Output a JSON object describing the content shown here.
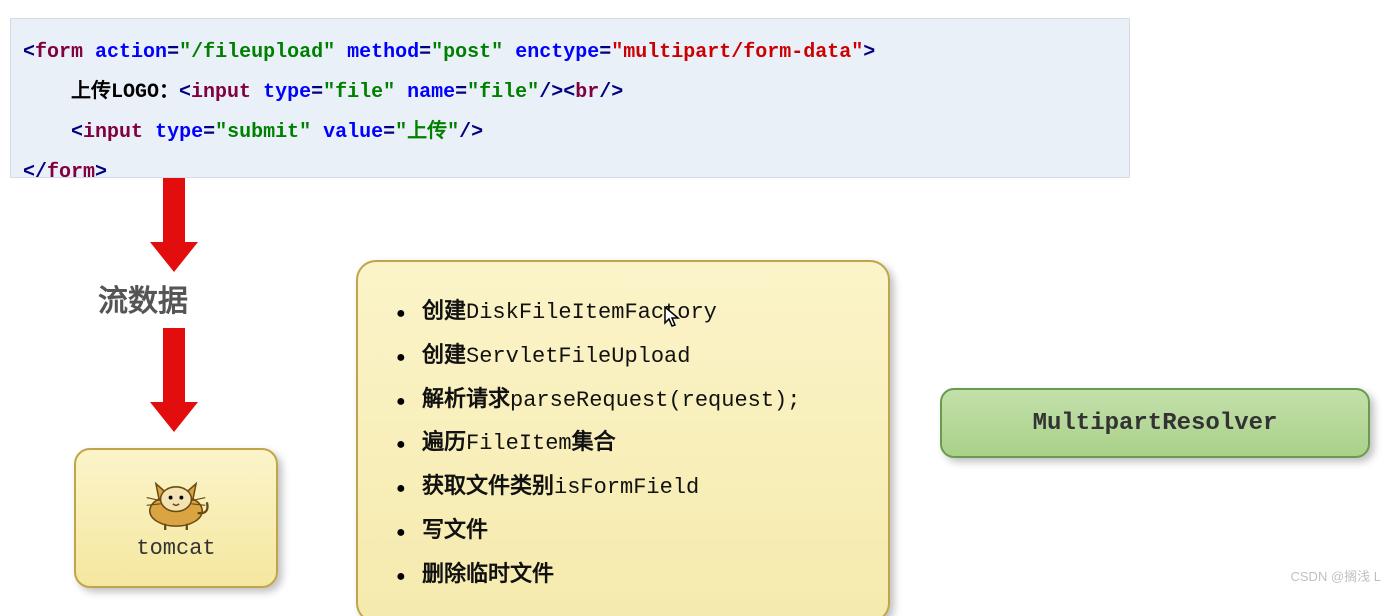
{
  "code": {
    "line1_tag": "form",
    "line1_attr1": "action",
    "line1_val1": "\"/fileupload\"",
    "line1_attr2": "method",
    "line1_val2": "\"post\"",
    "line1_attr3": "enctype",
    "line1_val3": "\"multipart/form-data\"",
    "line2_text": "上传LOGO：",
    "line2_tag": "input",
    "line2_attr1": "type",
    "line2_val1": "\"file\"",
    "line2_attr2": "name",
    "line2_val2": "\"file\"",
    "line2_br": "br",
    "line3_tag": "input",
    "line3_attr1": "type",
    "line3_val1": "\"submit\"",
    "line3_attr2": "value",
    "line3_val2": "\"上传\"",
    "line4_tag": "form"
  },
  "flow_label": "流数据",
  "tomcat": {
    "label": "tomcat",
    "icon_name": "tomcat-icon"
  },
  "steps": [
    {
      "bold": "创建",
      "mono": "DiskFileItemFactory"
    },
    {
      "bold": "创建",
      "mono": "ServletFileUpload"
    },
    {
      "bold": "解析请求",
      "mono": "parseRequest(request);"
    },
    {
      "bold": "遍历",
      "mono": "FileItem",
      "bold_after": "集合"
    },
    {
      "bold": "获取文件类别",
      "mono": "isFormField"
    },
    {
      "bold": "写文件",
      "mono": ""
    },
    {
      "bold": "删除临时文件",
      "mono": ""
    }
  ],
  "resolver": {
    "label": "MultipartResolver"
  },
  "watermark": "CSDN @搁浅  L"
}
